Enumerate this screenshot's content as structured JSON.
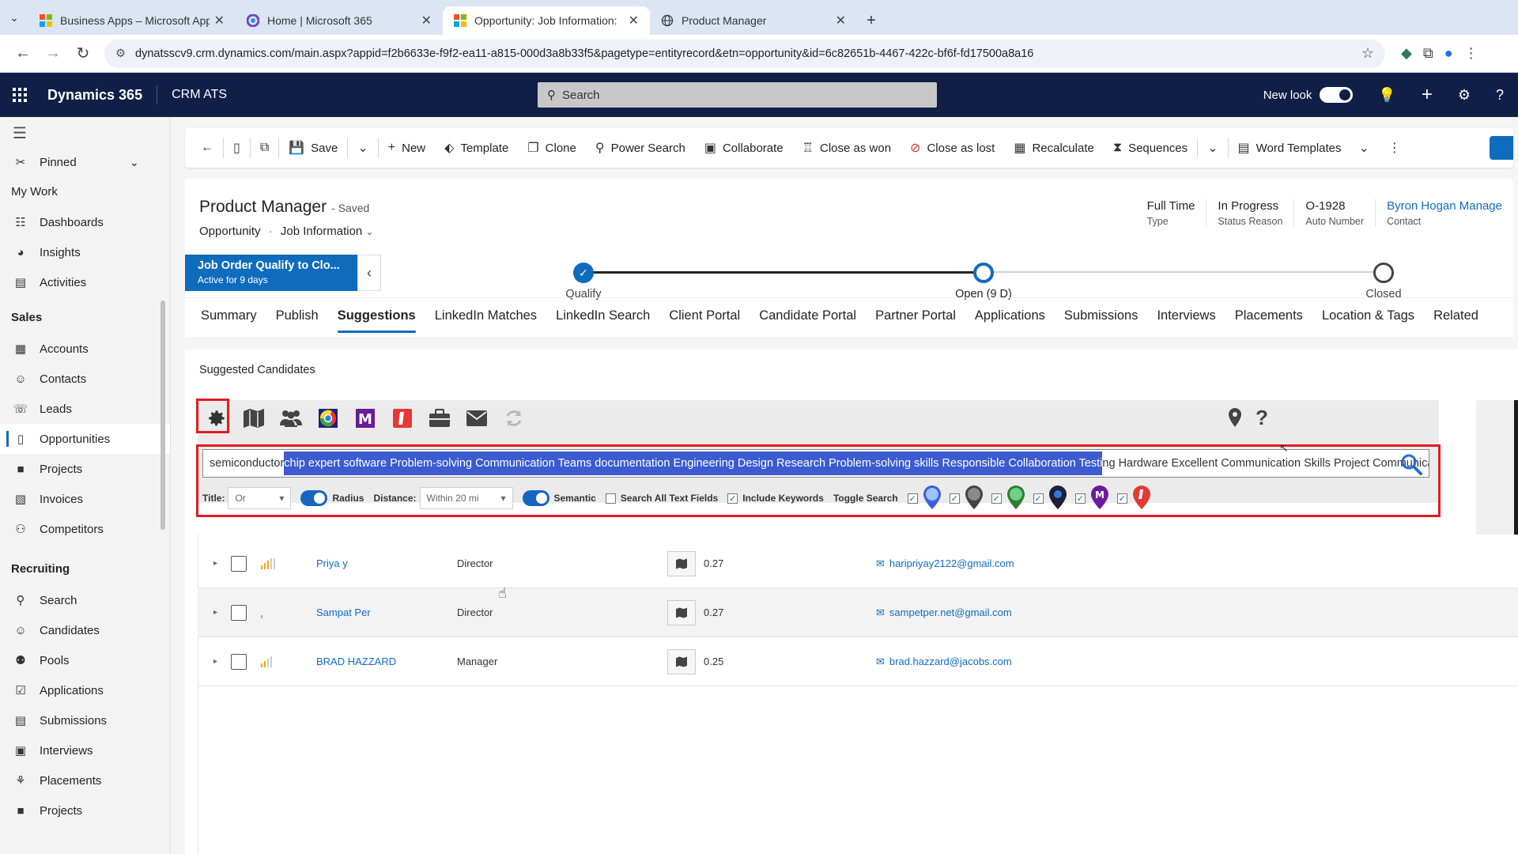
{
  "browser": {
    "tabs": [
      {
        "label": "Business Apps – Microsoft App",
        "icon": "microsoft-icon",
        "active": false
      },
      {
        "label": "Home | Microsoft 365",
        "icon": "m365-icon",
        "active": false
      },
      {
        "label": "Opportunity: Job Information: ",
        "icon": "microsoft-icon",
        "active": true
      },
      {
        "label": "Product Manager",
        "icon": "globe-icon",
        "active": false
      }
    ],
    "url": "dynatsscv9.crm.dynamics.com/main.aspx?appid=f2b6633e-f9f2-ea11-a815-000d3a8b33f5&pagetype=entityrecord&etn=opportunity&id=6c82651b-4467-422c-bf6f-fd17500a8a16"
  },
  "app": {
    "brand": "Dynamics 365",
    "name": "CRM ATS",
    "search_placeholder": "Search",
    "new_look_label": "New look"
  },
  "nav": {
    "pinned": "Pinned",
    "sections": [
      {
        "header": "My Work",
        "items": [
          {
            "label": "Dashboards",
            "icon": "dashboard-icon"
          },
          {
            "label": "Insights",
            "icon": "insights-icon"
          },
          {
            "label": "Activities",
            "icon": "activities-icon"
          }
        ]
      },
      {
        "header": "Sales",
        "items": [
          {
            "label": "Accounts",
            "icon": "accounts-icon"
          },
          {
            "label": "Contacts",
            "icon": "contacts-icon"
          },
          {
            "label": "Leads",
            "icon": "leads-icon"
          },
          {
            "label": "Opportunities",
            "icon": "opportunities-icon",
            "selected": true
          },
          {
            "label": "Projects",
            "icon": "projects-icon"
          },
          {
            "label": "Invoices",
            "icon": "invoices-icon"
          },
          {
            "label": "Competitors",
            "icon": "competitors-icon"
          }
        ]
      },
      {
        "header": "Recruiting",
        "items": [
          {
            "label": "Search",
            "icon": "search-icon"
          },
          {
            "label": "Candidates",
            "icon": "candidates-icon"
          },
          {
            "label": "Pools",
            "icon": "pools-icon"
          },
          {
            "label": "Applications",
            "icon": "applications-icon"
          },
          {
            "label": "Submissions",
            "icon": "submissions-icon"
          },
          {
            "label": "Interviews",
            "icon": "interviews-icon"
          },
          {
            "label": "Placements",
            "icon": "placements-icon"
          },
          {
            "label": "Projects",
            "icon": "projects-icon"
          }
        ]
      }
    ]
  },
  "commands": [
    "Save",
    "New",
    "Template",
    "Clone",
    "Power Search",
    "Collaborate",
    "Close as won",
    "Close as lost",
    "Recalculate",
    "Sequences",
    "Word Templates"
  ],
  "record": {
    "title": "Product Manager",
    "saved": "- Saved",
    "entity": "Opportunity",
    "form": "Job Information",
    "header_fields": [
      {
        "value": "Full Time",
        "label": "Type",
        "link": false
      },
      {
        "value": "In Progress",
        "label": "Status Reason",
        "link": false
      },
      {
        "value": "O-1928",
        "label": "Auto Number",
        "link": false
      },
      {
        "value": "Byron Hogan Manage",
        "label": "Contact",
        "link": true
      }
    ]
  },
  "bpf": {
    "stage_name": "Job Order Qualify to Clo...",
    "stage_sub": "Active for 9 days",
    "stages": [
      "Qualify",
      "Open  (9 D)",
      "Closed"
    ]
  },
  "form_tabs": [
    "Summary",
    "Publish",
    "Suggestions",
    "LinkedIn Matches",
    "LinkedIn Search",
    "Client Portal",
    "Candidate Portal",
    "Partner Portal",
    "Applications",
    "Submissions",
    "Interviews",
    "Placements",
    "Location & Tags",
    "Related"
  ],
  "active_tab": "Suggestions",
  "suggested": {
    "title": "Suggested Candidates",
    "keywords_before": "semiconductor ",
    "keywords_selected": "chip expert  software Problem-solving Communication Teams documentation Engineering Design Research Problem-solving skills Responsible Collaboration Testi",
    "keywords_after": "ng Hardware Excellent Communication Skills Project Communicator",
    "opts": {
      "title_label": "Title:",
      "title_value": "Or",
      "radius_label": "Radius",
      "distance_label": "Distance:",
      "distance_value": "Within 20 mi",
      "semantic_label": "Semantic",
      "search_all_label": "Search All Text Fields",
      "include_keywords_label": "Include Keywords",
      "toggle_search_label": "Toggle Search"
    },
    "candidates": [
      {
        "name": "Priya y",
        "title": "Director",
        "score": "0.27",
        "email": "haripriyay2122@gmail.com",
        "strength": 3
      },
      {
        "name": "Sampat Per",
        "title": "Director",
        "score": "0.27",
        "email": "sampetper.net@gmail.com",
        "strength": 1
      },
      {
        "name": "BRAD HAZZARD",
        "title": "Manager",
        "score": "0.25",
        "email": "brad.hazzard@jacobs.com",
        "strength": 2
      }
    ]
  },
  "colors": {
    "header_bg": "#0f1f46",
    "accent": "#0f6cbd",
    "highlight_box": "#e31b23",
    "selection": "#3b5bcf"
  }
}
